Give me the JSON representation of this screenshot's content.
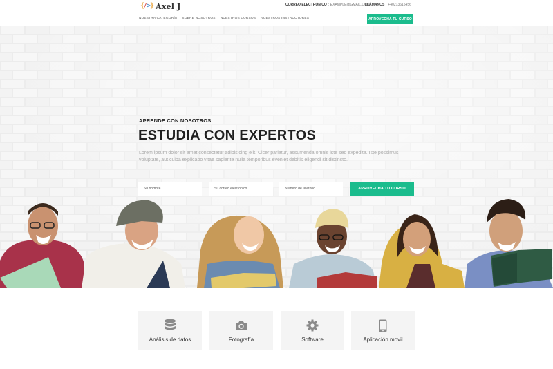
{
  "brand": {
    "name": "Axel J",
    "mark": "{/>}"
  },
  "contact": {
    "email_label": "CORREO ELECTRÓNICO :",
    "email_value": "EXAMPLE@GMAIL.COM",
    "phone_label": "LLÁMANOS :",
    "phone_value": "+40213615456"
  },
  "nav": {
    "items": [
      {
        "label": "NUESTRA CATEGORÍA"
      },
      {
        "label": "SOBRE NOSOTROS"
      },
      {
        "label": "NUESTROS CURSOS"
      },
      {
        "label": "NUESTROS INSTRUCTORES"
      }
    ],
    "cta_label": "APROVECHA TU CURSO"
  },
  "hero": {
    "kicker": "APRENDE CON NOSOTROS",
    "headline": "ESTUDIA CON EXPERTOS",
    "lead": "Lorem ipsum dolor sit amet consectetur adipisicing elit. Cicer pariatur, assumenda omnis iste sed expedita. Iste possimus voluptate, aut culpa explicabo vitae sapiente nulla temporibus eveniet debitis eligendi sit distincto.",
    "form": {
      "name_placeholder": "Su nombre",
      "email_placeholder": "Su correo electrónico",
      "phone_placeholder": "Número de teléfono",
      "submit_label": "APROVECHA TU CURSO"
    }
  },
  "features": [
    {
      "label": "Análisis de datos",
      "icon": "database-icon"
    },
    {
      "label": "Fotografía",
      "icon": "camera-icon"
    },
    {
      "label": "Software",
      "icon": "gear-icon"
    },
    {
      "label": "Aplicación movil",
      "icon": "mobile-icon"
    }
  ],
  "colors": {
    "accent": "#1bbc8d",
    "icon_gray": "#8a8a8a",
    "card_bg": "#f4f4f4"
  }
}
